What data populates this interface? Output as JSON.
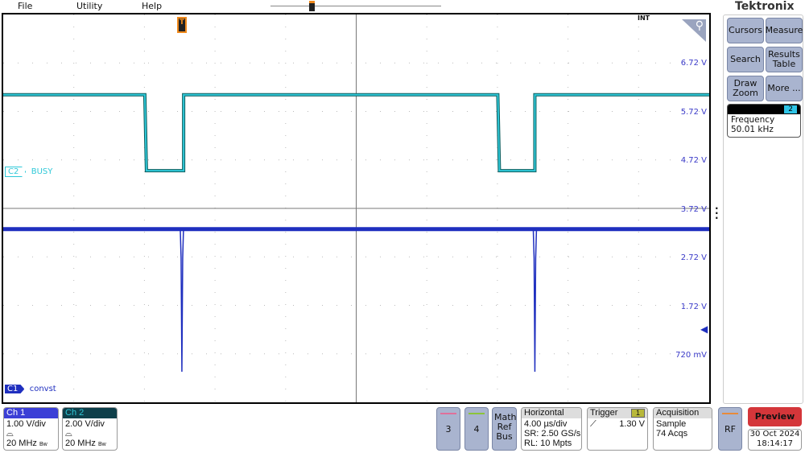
{
  "menu": [
    "File",
    "Utility",
    "Help"
  ],
  "brand": "Tektronix",
  "display": {
    "int_label": "INT",
    "voltage_labels": [
      "6.72 V",
      "5.72 V",
      "4.72 V",
      "3.72 V",
      "2.72 V",
      "1.72 V",
      "720 mV"
    ],
    "voltage_values": [
      6.72,
      5.72,
      4.72,
      3.72,
      2.72,
      1.72,
      0.72
    ],
    "c2_tag": "C2",
    "c2_label": "BUSY",
    "c1_tag": "C1",
    "c1_label": "convst",
    "trigger_marker": "T",
    "colors": {
      "ch1": "#1f2fbf",
      "ch2": "#2ec8d8",
      "ch2_dark": "#0d5c5c"
    },
    "traces": {
      "time_per_div_us": 4,
      "ch2": {
        "high_v": 6.08,
        "low_v": 4.52,
        "low_intervals_us": [
          [
            -12,
            -9.8
          ],
          [
            8,
            10.1
          ]
        ]
      },
      "ch1": {
        "level_v": 3.32,
        "spike_v": 0.39,
        "spikes_us": [
          -9.9,
          10.1
        ]
      }
    }
  },
  "side": {
    "buttons": [
      "Cursors",
      "Measure",
      "Search",
      "Results Table",
      "Draw Zoom",
      "More ..."
    ],
    "measure": {
      "channel": "2",
      "name": "Frequency",
      "value": "50.01 kHz"
    }
  },
  "bottom": {
    "ch1": {
      "title": "Ch 1",
      "scale": "1.00 V/div",
      "bw": "20 MHz"
    },
    "ch2": {
      "title": "Ch 2",
      "scale": "2.00 V/div",
      "bw": "20 MHz"
    },
    "ch3": "3",
    "ch4": "4",
    "math": "Math Ref Bus",
    "horizontal": {
      "title": "Horizontal",
      "lines": [
        "4.00 µs/div",
        "SR: 2.50 GS/s",
        "RL: 10 Mpts"
      ]
    },
    "trigger": {
      "title": "Trigger",
      "source": "1",
      "level": "1.30 V"
    },
    "acquisition": {
      "title": "Acquisition",
      "lines": [
        "Sample",
        "74 Acqs"
      ]
    },
    "rf": "RF",
    "preview": "Preview",
    "date": "30 Oct 2024",
    "time": "18:14:17"
  }
}
